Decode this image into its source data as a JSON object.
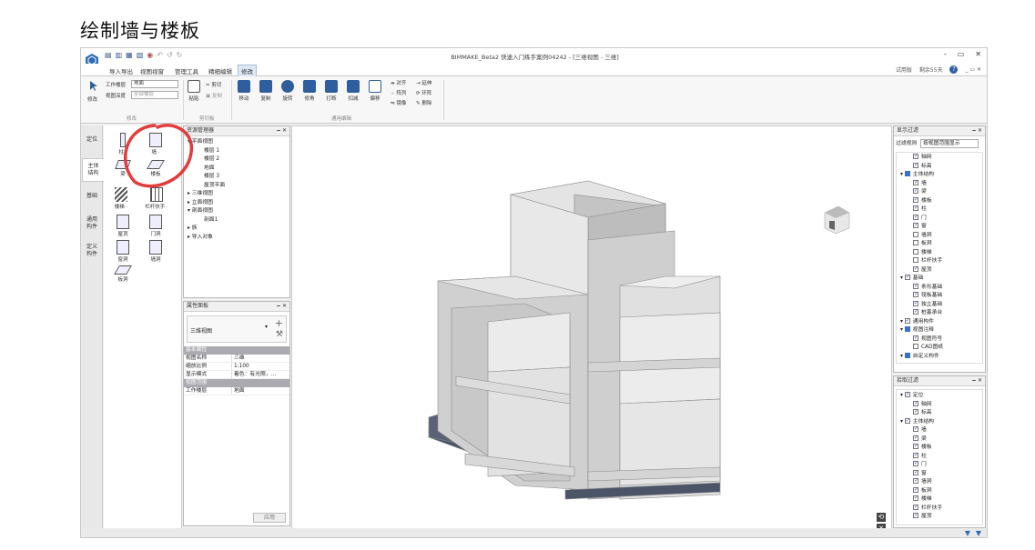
{
  "heading": "绘制墙与楼板",
  "window_title": "BIMMAKE_Beta2 快速入门练手案例04242 - [三维视图 - 三维]",
  "menu": [
    "导入导出",
    "视图视窗",
    "管理工具",
    "精细编辑",
    "修改"
  ],
  "right_menu": {
    "trial": "试用版",
    "days": "剩余55天",
    "help": "?"
  },
  "window_buttons": [
    "-",
    "▭",
    "✕"
  ],
  "ribbon": {
    "modify_label": "修改",
    "working_level_label": "工作楼层",
    "working_level_value": "地面",
    "view_depth_label": "视图深度",
    "view_depth_value": "全部楼层",
    "group_modify": "修改",
    "paste": "粘贴",
    "cut": "剪切",
    "copy_clip": "复制",
    "group_clipboard": "剪切板",
    "move": "移动",
    "copy": "复制",
    "rotate": "旋转",
    "trim": "修角",
    "break": "打断",
    "subtract": "扣减",
    "offset": "偏移",
    "align": "对齐",
    "extend": "延伸",
    "array": "阵列",
    "ring": "环阵",
    "mirror": "镜像",
    "delete": "删除",
    "group_edit": "通用编辑"
  },
  "vtabs": [
    "定位",
    "主体\n结构",
    "基础",
    "通用\n构件",
    "定义\n构件"
  ],
  "tools": [
    {
      "label": "柱 ·"
    },
    {
      "label": "墙 ·"
    },
    {
      "label": "梁"
    },
    {
      "label": "楼板"
    },
    {
      "label": "楼梯 ·"
    },
    {
      "label": "栏杆扶手 ·"
    },
    {
      "label": "屋顶"
    },
    {
      "label": "门洞"
    },
    {
      "label": "窗洞"
    },
    {
      "label": "墙洞"
    },
    {
      "label": "板洞"
    }
  ],
  "resource": {
    "title": "资源管理器",
    "pin": "🗕 ✕",
    "items": [
      "▾ 平面视图",
      "楼层 1",
      "楼层 2",
      "地面",
      "楼层 3",
      "屋顶平面",
      "▸ 三维视图",
      "▸ 立面视图",
      "▾ 剖面视图",
      "剖面1",
      "▸ 族",
      "▸ 导入对象"
    ]
  },
  "props": {
    "title": "属性面板",
    "pin": "🗕 ✕",
    "type": "三维视图",
    "section_basic": "基本属性",
    "rows": [
      [
        "视图名称",
        "三维"
      ],
      [
        "缩放比例",
        "1:100"
      ],
      [
        "显示模式",
        "着色：有光照，..."
      ]
    ],
    "section_range": "视图范围",
    "range_rows": [
      [
        "工作楼层",
        "地面"
      ]
    ],
    "apply": "应用"
  },
  "display_filter": {
    "title": "显示过滤",
    "pin": "🗕 ✕",
    "rule_label": "过滤规则",
    "rule_value": "按视图范围显示",
    "items": [
      [
        "轴网",
        1,
        1
      ],
      [
        "标高",
        1,
        1
      ],
      [
        "主体结构",
        0,
        2
      ],
      [
        "墙",
        1,
        1
      ],
      [
        "梁",
        1,
        1
      ],
      [
        "楼板",
        1,
        1
      ],
      [
        "柱",
        1,
        1
      ],
      [
        "门",
        1,
        1
      ],
      [
        "窗",
        1,
        1
      ],
      [
        "墙洞",
        0,
        1
      ],
      [
        "板洞",
        0,
        1
      ],
      [
        "楼梯",
        0,
        1
      ],
      [
        "栏杆扶手",
        0,
        1
      ],
      [
        "屋顶",
        1,
        1
      ],
      [
        "基础",
        1,
        0
      ],
      [
        "条形基础",
        1,
        1
      ],
      [
        "筏板基础",
        1,
        1
      ],
      [
        "独立基础",
        1,
        1
      ],
      [
        "桩基承台",
        1,
        1
      ],
      [
        "通用构件",
        1,
        0
      ],
      [
        "视图注释",
        0,
        2
      ],
      [
        "视图符号",
        1,
        1
      ],
      [
        "CAD图纸",
        0,
        1
      ],
      [
        "自定义构件",
        0,
        2
      ]
    ]
  },
  "pick_filter": {
    "title": "拾取过滤",
    "pin": "🗕 ✕",
    "items": [
      [
        "定位",
        1,
        0
      ],
      [
        "轴网",
        1,
        1
      ],
      [
        "标高",
        1,
        1
      ],
      [
        "主体结构",
        1,
        0
      ],
      [
        "墙",
        1,
        1
      ],
      [
        "梁",
        1,
        1
      ],
      [
        "楼板",
        1,
        1
      ],
      [
        "柱",
        1,
        1
      ],
      [
        "门",
        1,
        1
      ],
      [
        "窗",
        1,
        1
      ],
      [
        "墙洞",
        1,
        1
      ],
      [
        "板洞",
        1,
        1
      ],
      [
        "楼梯",
        1,
        1
      ],
      [
        "栏杆扶手",
        1,
        1
      ],
      [
        "屋顶",
        1,
        1
      ]
    ]
  },
  "viewport_controls": {
    "rotate": "⟲",
    "close": "✕"
  },
  "status_icons": [
    "▼",
    "▼"
  ]
}
